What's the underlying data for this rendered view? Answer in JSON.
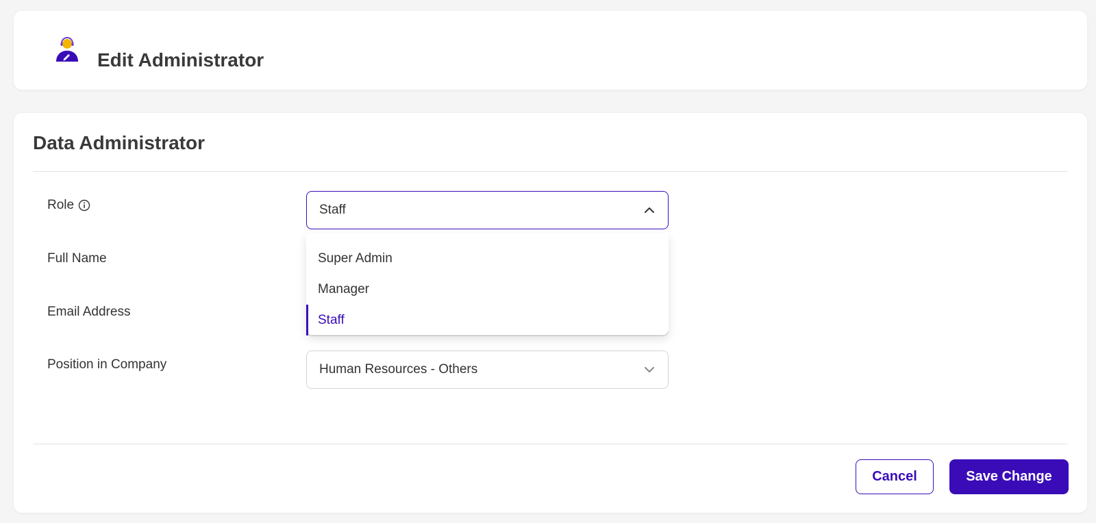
{
  "header": {
    "title": "Edit Administrator",
    "icon": "admin-edit-icon"
  },
  "section": {
    "title": "Data Administrator"
  },
  "form": {
    "role": {
      "label": "Role",
      "value": "Staff",
      "options": [
        "Super Admin",
        "Manager",
        "Staff"
      ],
      "selected_index": 2
    },
    "full_name": {
      "label": "Full Name"
    },
    "email": {
      "label": "Email Address"
    },
    "position": {
      "label": "Position in Company",
      "value": "Human Resources - Others"
    }
  },
  "actions": {
    "cancel_label": "Cancel",
    "save_label": "Save Change"
  },
  "colors": {
    "accent": "#3a0cb8",
    "avatar_head": "#f5b400"
  }
}
